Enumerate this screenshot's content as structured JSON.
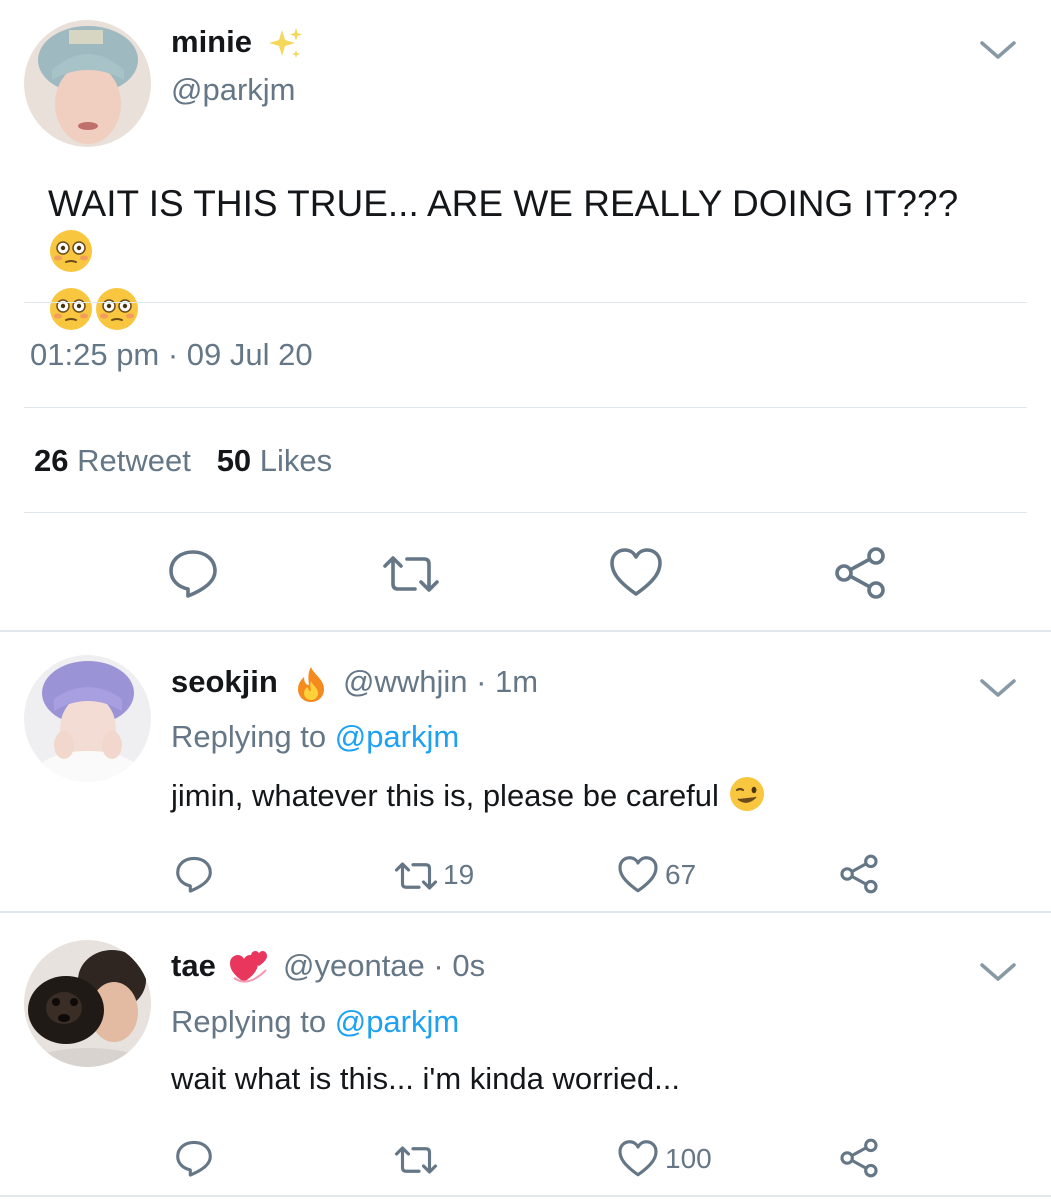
{
  "main_tweet": {
    "name": "minie",
    "name_emoji": "sparkles",
    "handle": "@parkjm",
    "text": "WAIT IS THIS TRUE... ARE WE REALLY DOING IT???",
    "text_emojis": [
      "flushed-face",
      "flushed-face",
      "flushed-face"
    ],
    "timestamp": "01:25 pm · 09 Jul 20",
    "retweet_count": "26",
    "retweet_label": "Retweet",
    "like_count": "50",
    "like_label": "Likes",
    "actions": [
      "reply-icon",
      "retweet-icon",
      "heart-icon",
      "share-icon"
    ]
  },
  "replies": [
    {
      "name": "seokjin",
      "name_emoji": "fire",
      "handle": "@wwhjin",
      "time": "· 1m",
      "replying_label": "Replying to",
      "replying_to": "@parkjm",
      "text": "jimin, whatever this is, please be careful",
      "text_emoji": "winking-face",
      "retweets": "19",
      "likes": "67"
    },
    {
      "name": "tae",
      "name_emoji": "revolving-hearts",
      "handle": "@yeontae",
      "time": "· 0s",
      "replying_label": "Replying to",
      "replying_to": "@parkjm",
      "text": "wait what is this... i'm kinda worried...",
      "retweets": "",
      "likes": "100"
    }
  ],
  "colors": {
    "text": "#14171a",
    "secondary": "#657786",
    "link": "#1da1f2",
    "divider": "#e1e8ed"
  }
}
